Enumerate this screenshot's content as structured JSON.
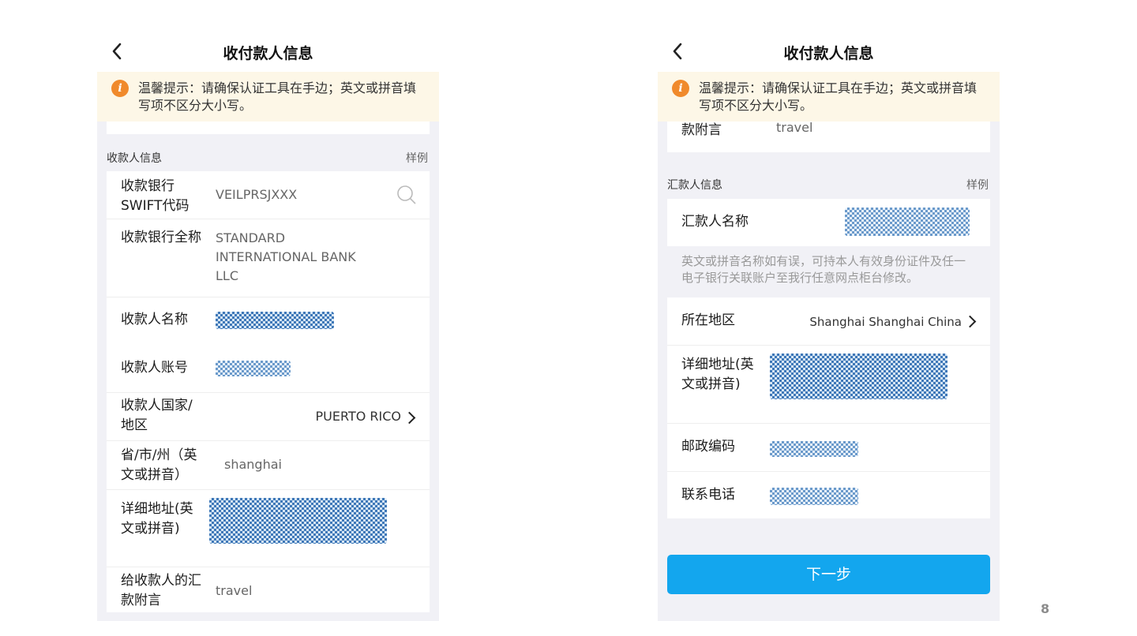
{
  "page_number": "8",
  "left": {
    "title": "收付款人信息",
    "tip": "温馨提示：请确保认证工具在手边；英文或拼音填写项不区分大小写。",
    "section_title": "收款人信息",
    "section_sample": "样例",
    "fields": {
      "swift_label": "收款银行SWIFT代码",
      "swift_value": "VEILPRSJXXX",
      "bank_label": "收款银行全称",
      "bank_value": "STANDARD INTERNATIONAL BANK LLC",
      "name_label": "收款人名称",
      "account_label": "收款人账号",
      "country_label": "收款人国家/地区",
      "country_value": "PUERTO RICO",
      "province_label": "省/市/州（英文或拼音）",
      "province_value": "shanghai",
      "address_label": "详细地址(英文或拼音)",
      "memo_label": "给收款人的汇款附言",
      "memo_value": "travel"
    }
  },
  "right": {
    "title": "收付款人信息",
    "tip": "温馨提示：请确保认证工具在手边；英文或拼音填写项不区分大小写。",
    "memo_label_partial": "给收款人的汇款附言",
    "memo_value": "travel",
    "section_title": "汇款人信息",
    "section_sample": "样例",
    "remitter_name_label": "汇款人名称",
    "note": "英文或拼音名称如有误，可持本人有效身份证件及任一电子银行关联账户至我行任意网点柜台修改。",
    "region_label": "所在地区",
    "region_value": "Shanghai Shanghai China",
    "address_label": "详细地址(英文或拼音)",
    "postcode_label": "邮政编码",
    "phone_label": "联系电话",
    "next_button": "下一步"
  },
  "colors": {
    "accent": "#13a6ee",
    "tip_bg": "#fdf7e7",
    "tip_icon": "#f08a2c",
    "page_bg": "#f1f1f6"
  },
  "icons": [
    "back-arrow-icon",
    "info-icon",
    "search-icon",
    "chevron-right-icon"
  ]
}
